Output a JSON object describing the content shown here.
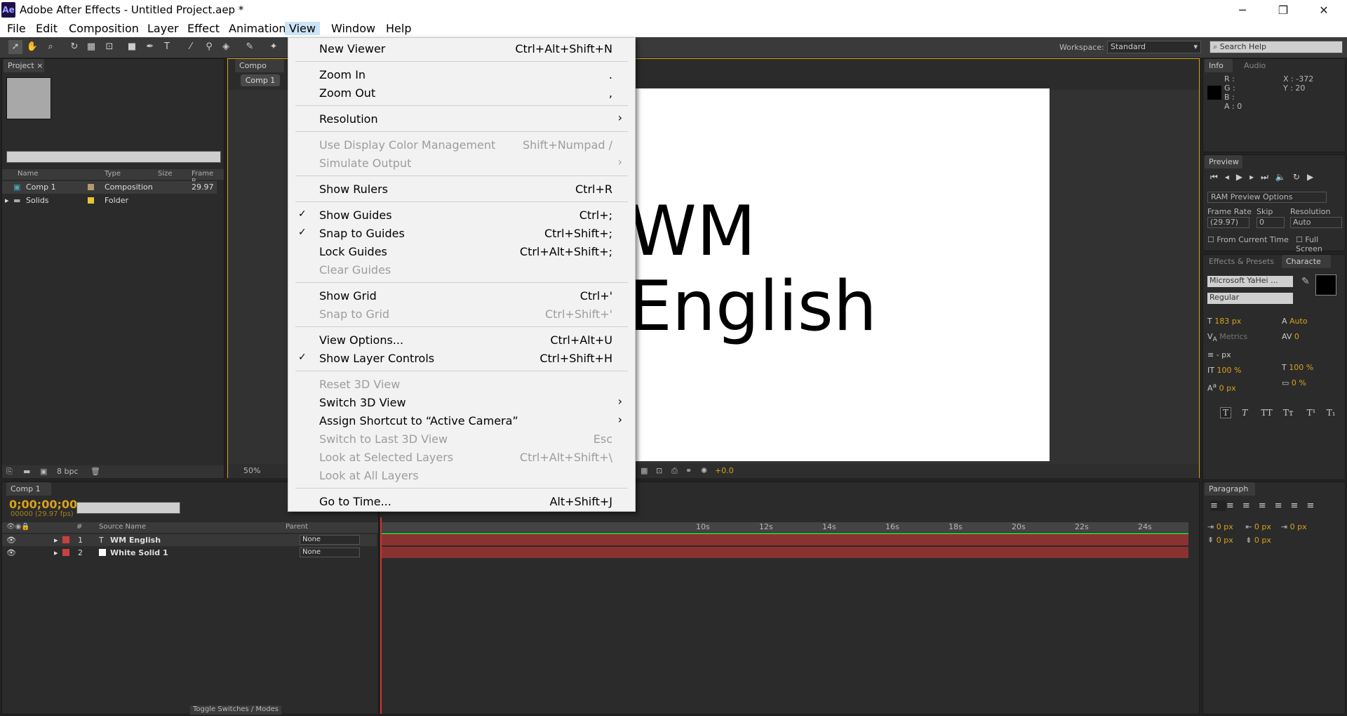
{
  "window": {
    "title": "Adobe After Effects - Untitled Project.aep *",
    "app_icon": "Ae",
    "minimize": "─",
    "restore": "❐",
    "close": "✕"
  },
  "menubar": [
    "File",
    "Edit",
    "Composition",
    "Layer",
    "Effect",
    "Animation",
    "View",
    "Window",
    "Help"
  ],
  "toolbar": {
    "workspace_label": "Workspace:",
    "workspace_value": "Standard",
    "search_help_placeholder": "Search Help"
  },
  "project_panel": {
    "tab": "Project",
    "columns": [
      "Name",
      "Type",
      "Size",
      "Frame R..."
    ],
    "items": [
      {
        "name": "Comp 1",
        "type": "Composition",
        "frame_rate": "29.97",
        "color": "#b59a6b"
      },
      {
        "name": "Solids",
        "type": "Folder",
        "frame_rate": "",
        "color": "#e6c536"
      }
    ],
    "bpc": "8 bpc"
  },
  "comp_panel": {
    "tab": "Compo",
    "sub_tab": "Comp 1",
    "zoom": "50%",
    "exposure": "+0.0",
    "text_line1": "WM",
    "text_line2": "English"
  },
  "view_menu": {
    "items": [
      {
        "label": "New Viewer",
        "shortcut": "Ctrl+Alt+Shift+N",
        "enabled": true
      },
      {
        "label": "Zoom In",
        "shortcut": ".",
        "enabled": true
      },
      {
        "label": "Zoom Out",
        "shortcut": ",",
        "enabled": true
      },
      {
        "label": "Resolution",
        "shortcut": "",
        "enabled": true,
        "submenu": true
      },
      {
        "label": "Use Display Color Management",
        "shortcut": "Shift+Numpad /",
        "enabled": false
      },
      {
        "label": "Simulate Output",
        "shortcut": "",
        "enabled": false,
        "submenu": true
      },
      {
        "label": "Show Rulers",
        "shortcut": "Ctrl+R",
        "enabled": true
      },
      {
        "label": "Show Guides",
        "shortcut": "Ctrl+;",
        "enabled": true,
        "checked": true
      },
      {
        "label": "Snap to Guides",
        "shortcut": "Ctrl+Shift+;",
        "enabled": true,
        "checked": true
      },
      {
        "label": "Lock Guides",
        "shortcut": "Ctrl+Alt+Shift+;",
        "enabled": true
      },
      {
        "label": "Clear Guides",
        "shortcut": "",
        "enabled": false
      },
      {
        "label": "Show Grid",
        "shortcut": "Ctrl+'",
        "enabled": true
      },
      {
        "label": "Snap to Grid",
        "shortcut": "Ctrl+Shift+'",
        "enabled": false
      },
      {
        "label": "View Options...",
        "shortcut": "Ctrl+Alt+U",
        "enabled": true
      },
      {
        "label": "Show Layer Controls",
        "shortcut": "Ctrl+Shift+H",
        "enabled": true,
        "checked": true
      },
      {
        "label": "Reset 3D View",
        "shortcut": "",
        "enabled": false
      },
      {
        "label": "Switch 3D View",
        "shortcut": "",
        "enabled": true,
        "submenu": true
      },
      {
        "label": "Assign Shortcut to “Active Camera”",
        "shortcut": "",
        "enabled": true,
        "submenu": true
      },
      {
        "label": "Switch to Last 3D View",
        "shortcut": "Esc",
        "enabled": false
      },
      {
        "label": "Look at Selected Layers",
        "shortcut": "Ctrl+Alt+Shift+\\",
        "enabled": false
      },
      {
        "label": "Look at All Layers",
        "shortcut": "",
        "enabled": false
      },
      {
        "label": "Go to Time...",
        "shortcut": "Alt+Shift+J",
        "enabled": true
      }
    ]
  },
  "info_panel": {
    "tabs": [
      "Info",
      "Audio"
    ],
    "r": "R :",
    "g": "G :",
    "b": "B :",
    "a": "A : 0",
    "x": "X : -372",
    "y": "Y : 20"
  },
  "preview_panel": {
    "tab": "Preview",
    "ram_options": "RAM Preview Options",
    "frame_rate_label": "Frame Rate",
    "skip_label": "Skip",
    "resolution_label": "Resolution",
    "frame_rate": "(29.97)",
    "skip": "0",
    "resolution": "Auto",
    "from_current": "From Current Time",
    "full_screen": "Full Screen"
  },
  "character_panel": {
    "tabs": [
      "Effects & Presets",
      "Characte"
    ],
    "font": "Microsoft YaHei ...",
    "style": "Regular",
    "size": "183 px",
    "leading": "Auto",
    "kerning": "Metrics",
    "tracking": "0",
    "stroke": "- px",
    "vscale": "100 %",
    "hscale": "100 %",
    "baseline": "0 px",
    "tsume": "0 %",
    "styles": [
      "T",
      "T",
      "TT",
      "Tт",
      "T¹",
      "T₁"
    ]
  },
  "paragraph_panel": {
    "tab": "Paragraph",
    "indent_values": [
      "0 px",
      "0 px",
      "0 px",
      "0 px",
      "0 px"
    ]
  },
  "timeline": {
    "tab": "Comp 1",
    "timecode": "0;00;00;00",
    "frames": "00000 (29.97 fps)",
    "columns": [
      "#",
      "Source Name",
      "Parent"
    ],
    "layers": [
      {
        "num": "1",
        "name": "WM English",
        "color": "#c94040",
        "parent": "None"
      },
      {
        "num": "2",
        "name": "White Solid 1",
        "color": "#c94040",
        "parent": "None"
      }
    ],
    "ticks": [
      "10s",
      "12s",
      "14s",
      "16s",
      "18s",
      "20s",
      "22s",
      "24s"
    ],
    "toggle": "Toggle Switches / Modes"
  }
}
